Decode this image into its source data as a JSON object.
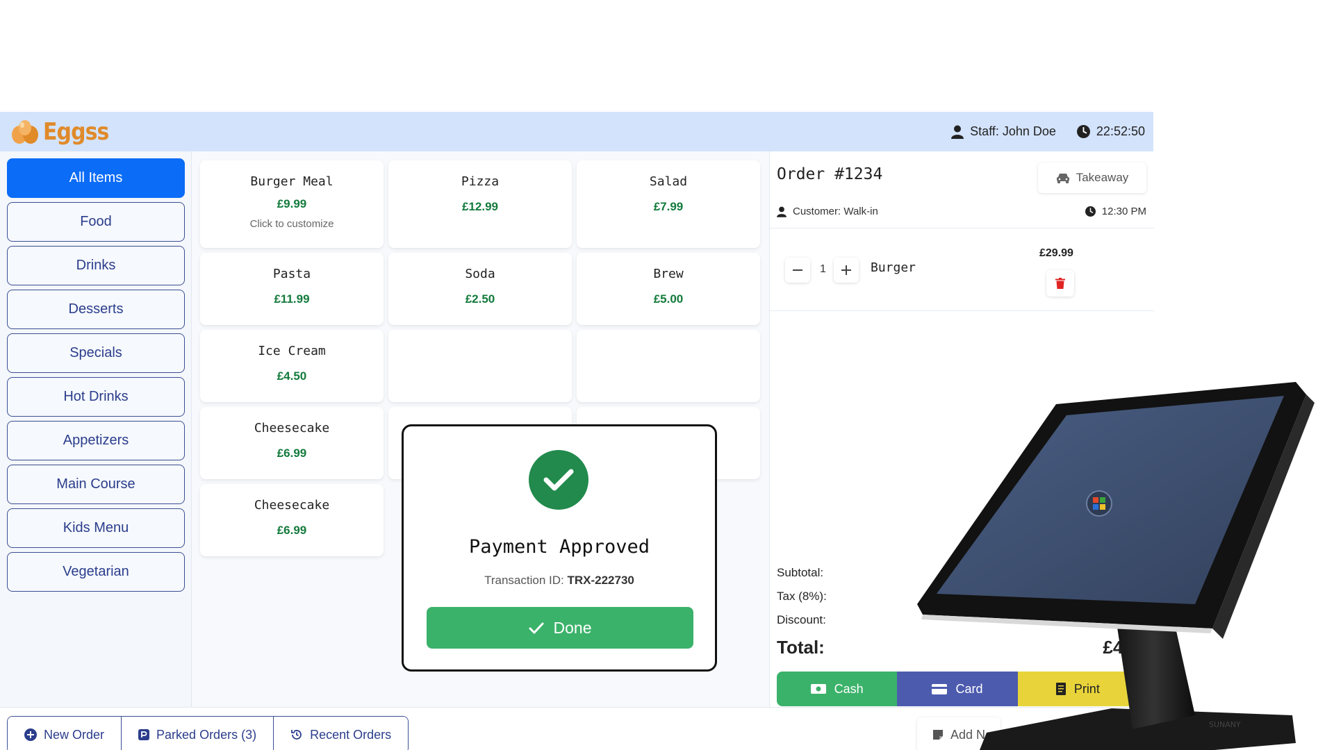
{
  "header": {
    "logo_text": "Eggss",
    "staff": "Staff: John Doe",
    "time": "22:52:50"
  },
  "sidebar": {
    "items": [
      {
        "label": "All Items",
        "active": true
      },
      {
        "label": "Food"
      },
      {
        "label": "Drinks"
      },
      {
        "label": "Desserts"
      },
      {
        "label": "Specials"
      },
      {
        "label": "Hot Drinks"
      },
      {
        "label": "Appetizers"
      },
      {
        "label": "Main Course"
      },
      {
        "label": "Kids Menu"
      },
      {
        "label": "Vegetarian"
      }
    ]
  },
  "products": [
    {
      "name": "Burger Meal",
      "price": "£9.99",
      "hint": "Click to customize"
    },
    {
      "name": "Pizza",
      "price": "£12.99"
    },
    {
      "name": "Salad",
      "price": "£7.99"
    },
    {
      "name": "Pasta",
      "price": "£11.99"
    },
    {
      "name": "Soda",
      "price": "£2.50"
    },
    {
      "name": "Brew",
      "price": "£5.00"
    },
    {
      "name": "Ice Cream",
      "price": "£4.50"
    },
    {
      "name": "Cheesecake",
      "price": "£6.99"
    },
    {
      "name": "Cheesecake",
      "price": "£6.99"
    }
  ],
  "order": {
    "title": "Order #1234",
    "type_label": "Takeaway",
    "customer": "Customer: Walk-in",
    "order_time": "12:30 PM",
    "items": [
      {
        "qty": "1",
        "name": "Burger",
        "price": "£29.99"
      }
    ],
    "subtotal_label": "Subtotal:",
    "tax_label": "Tax (8%):",
    "discount_label": "Discount:",
    "total_label": "Total:",
    "total_value": "£41.",
    "pay_buttons": {
      "cash": "Cash",
      "card": "Card",
      "print": "Print"
    }
  },
  "bottom_bar": {
    "new_order": "New Order",
    "parked_orders": "Parked Orders (3)",
    "recent_orders": "Recent Orders",
    "add_note": "Add N"
  },
  "modal": {
    "title": "Payment Approved",
    "transaction_label": "Transaction ID:",
    "transaction_id": "TRX-222730",
    "done_label": "Done"
  },
  "device": {
    "brand": "SUNANY"
  },
  "colors": {
    "header_bg": "#d3e3fc",
    "active_category": "#0b6cf7",
    "category_border": "#3a4e93",
    "price_green": "#137a3c",
    "success_green": "#3bb26a",
    "card_blue": "#4c5bae",
    "print_yellow": "#e8d43a",
    "delete_red": "#e02424"
  }
}
